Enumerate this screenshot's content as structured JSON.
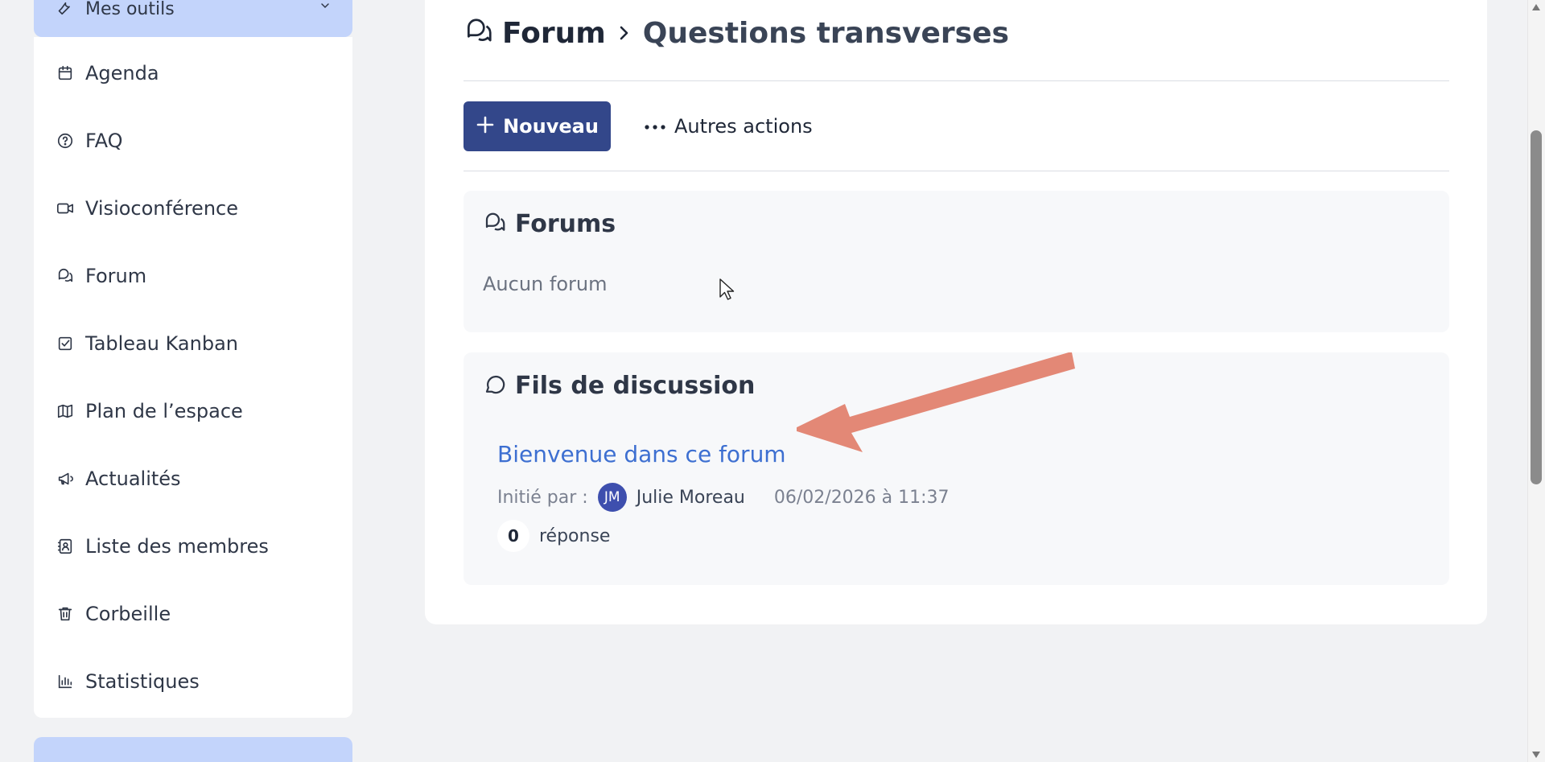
{
  "sidebar": {
    "tools_header_label": "Mes outils",
    "items": [
      {
        "label": "Agenda",
        "icon": "calendar-icon"
      },
      {
        "label": "FAQ",
        "icon": "question-circle-icon"
      },
      {
        "label": "Visioconférence",
        "icon": "video-camera-icon"
      },
      {
        "label": "Forum",
        "icon": "chat-bubbles-icon"
      },
      {
        "label": "Tableau Kanban",
        "icon": "checkbox-icon"
      },
      {
        "label": "Plan de l’espace",
        "icon": "map-icon"
      },
      {
        "label": "Actualités",
        "icon": "megaphone-icon"
      },
      {
        "label": "Liste des membres",
        "icon": "contact-book-icon"
      },
      {
        "label": "Corbeille",
        "icon": "trash-icon"
      },
      {
        "label": "Statistiques",
        "icon": "bar-chart-icon"
      }
    ]
  },
  "breadcrumb": {
    "root": "Forum",
    "current": "Questions transverses"
  },
  "toolbar": {
    "new_label": "Nouveau",
    "more_label": "Autres actions"
  },
  "forums_panel": {
    "title": "Forums",
    "empty_text": "Aucun forum"
  },
  "threads_panel": {
    "title": "Fils de discussion",
    "thread": {
      "title": "Bienvenue dans ce forum",
      "started_by_label": "Initié par :",
      "author_initials": "JM",
      "author_name": "Julie Moreau",
      "date": "06/02/2026 à 11:37",
      "reply_count": "0",
      "reply_label": "réponse"
    }
  },
  "colors": {
    "primary_button": "#33478a",
    "link": "#3d6fd1",
    "sidebar_highlight": "#c3d4fb",
    "annotation_arrow": "#e38876"
  }
}
